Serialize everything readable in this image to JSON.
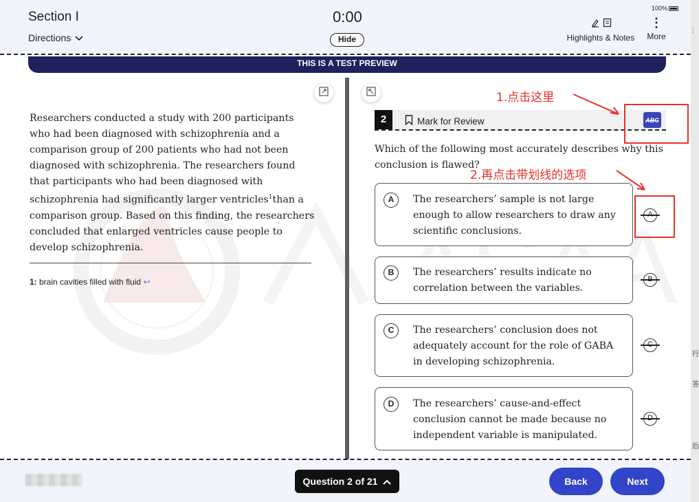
{
  "header": {
    "section_title": "Section I",
    "directions_label": "Directions",
    "timer": "00:00",
    "timer_display": "0:00",
    "hide_label": "Hide",
    "highlights_notes_label": "Highlights & Notes",
    "more_label": "More",
    "battery": "100%"
  },
  "banner": {
    "text": "THIS IS A TEST PREVIEW"
  },
  "watermark": {
    "text": "ASAA"
  },
  "passage": {
    "text_before_sup": "Researchers conducted a study with 200 participants who had been diagnosed with schizophrenia and a comparison group of 200 patients who had not been diagnosed with schizophrenia. The researchers found that participants who had been diagnosed with schizophrenia had significantly larger ventricles",
    "sup": "1",
    "text_after_sup": "than a comparison group. Based on this finding, the researchers concluded that enlarged ventricles cause people to develop schizophrenia.",
    "footnote_num": "1:",
    "footnote_text": "brain cavities filled with fluid",
    "footnote_return": "↩"
  },
  "question": {
    "number": "2",
    "mark_for_review": "Mark for Review",
    "abc_label": "ABC",
    "stem": "Which of the following most accurately describes why this conclusion is flawed?",
    "choices": [
      {
        "letter": "A",
        "text": "The researchers’ sample is not large enough to allow researchers to draw any scientific conclusions."
      },
      {
        "letter": "B",
        "text": "The researchers’ results indicate no correlation between the variables."
      },
      {
        "letter": "C",
        "text": "The researchers’ conclusion does not adequately account for the role of GABA in developing schizophrenia."
      },
      {
        "letter": "D",
        "text": "The researchers’ cause-and-effect conclusion cannot be made because no independent variable is manipulated."
      }
    ]
  },
  "annotations": {
    "step1": "1.点击这里",
    "step2": "2.再点击带划线的选项",
    "color": "#e8302a"
  },
  "footer": {
    "question_nav": "Question 2 of 21",
    "back_label": "Back",
    "next_label": "Next"
  },
  "side_strip": [
    "行",
    "答",
    "后"
  ],
  "colors": {
    "banner": "#1e215e",
    "button": "#3244c8",
    "bar": "#f1f4fb"
  }
}
